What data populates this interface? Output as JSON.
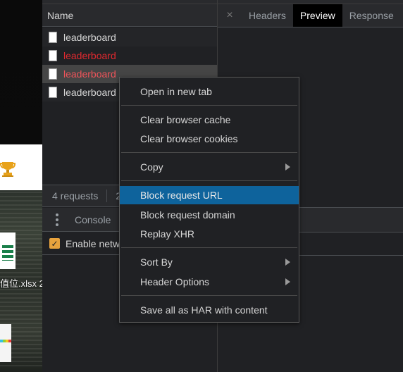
{
  "desktop": {
    "file_label": "值位.xlsx  2",
    "icons": [
      "trophy-icon",
      "spreadsheet-icon",
      "image-thumbnail"
    ]
  },
  "network": {
    "column_header": "Name",
    "requests": [
      {
        "name": "leaderboard",
        "status": "normal"
      },
      {
        "name": "leaderboard",
        "status": "error"
      },
      {
        "name": "leaderboard",
        "status": "error-selected"
      },
      {
        "name": "leaderboard",
        "status": "normal"
      }
    ],
    "summary": "4 requests",
    "summary_truncated": "2"
  },
  "drawer": {
    "tab": "Console",
    "enable_checkbox_label": "Enable netw",
    "enable_checked": true
  },
  "details": {
    "close_glyph": "×",
    "tabs": [
      {
        "label": "Headers",
        "active": false
      },
      {
        "label": "Preview",
        "active": true
      },
      {
        "label": "Response",
        "active": false
      }
    ]
  },
  "context_menu": {
    "groups": [
      [
        {
          "label": "Open in new tab",
          "submenu": false,
          "highlighted": false
        }
      ],
      [
        {
          "label": "Clear browser cache",
          "submenu": false,
          "highlighted": false
        },
        {
          "label": "Clear browser cookies",
          "submenu": false,
          "highlighted": false
        }
      ],
      [
        {
          "label": "Copy",
          "submenu": true,
          "highlighted": false
        }
      ],
      [
        {
          "label": "Block request URL",
          "submenu": false,
          "highlighted": true
        },
        {
          "label": "Block request domain",
          "submenu": false,
          "highlighted": false
        },
        {
          "label": "Replay XHR",
          "submenu": false,
          "highlighted": false
        }
      ],
      [
        {
          "label": "Sort By",
          "submenu": true,
          "highlighted": false
        },
        {
          "label": "Header Options",
          "submenu": true,
          "highlighted": false
        }
      ],
      [
        {
          "label": "Save all as HAR with content",
          "submenu": false,
          "highlighted": false
        }
      ]
    ]
  },
  "colors": {
    "background": "#202124",
    "toolbar": "#292a2d",
    "error_text": "#e0292f",
    "selected_error_text": "#f0545a",
    "menu_highlight": "#0e639c",
    "checkbox": "#e8a33d",
    "active_tab_bg": "#000000"
  }
}
